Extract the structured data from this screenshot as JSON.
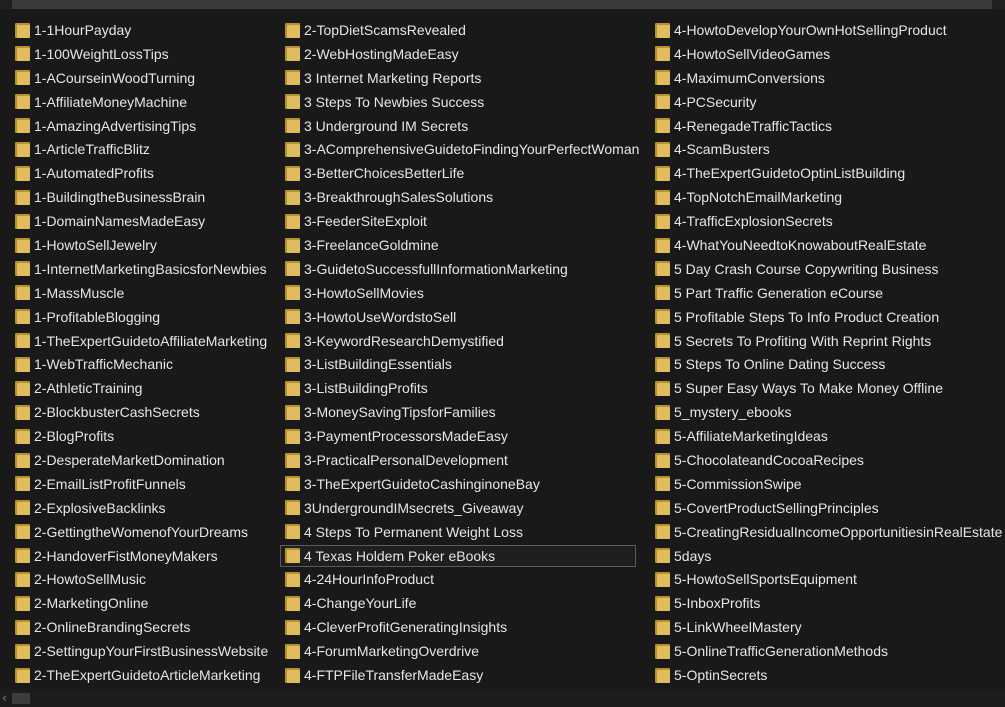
{
  "folder_icon": "folder-icon",
  "colors": {
    "background": "#191919",
    "text": "#e6e6e6",
    "folder_light": "#e1bc5e",
    "folder_dark": "#b8902e",
    "selection_border": "#5b5b5b"
  },
  "selected_item": "4 Texas Holdem Poker eBooks",
  "columns": [
    {
      "items": [
        "1-1HourPayday",
        "1-100WeightLossTips",
        "1-ACourseinWoodTurning",
        "1-AffiliateMoneyMachine",
        "1-AmazingAdvertisingTips",
        "1-ArticleTrafficBlitz",
        "1-AutomatedProfits",
        "1-BuildingtheBusinessBrain",
        "1-DomainNamesMadeEasy",
        "1-HowtoSellJewelry",
        "1-InternetMarketingBasicsforNewbies",
        "1-MassMuscle",
        "1-ProfitableBlogging",
        "1-TheExpertGuidetoAffiliateMarketing",
        "1-WebTrafficMechanic",
        "2-AthleticTraining",
        "2-BlockbusterCashSecrets",
        "2-BlogProfits",
        "2-DesperateMarketDomination",
        "2-EmailListProfitFunnels",
        "2-ExplosiveBacklinks",
        "2-GettingtheWomenofYourDreams",
        "2-HandoverFistMoneyMakers",
        "2-HowtoSellMusic",
        "2-MarketingOnline",
        "2-OnlineBrandingSecrets",
        "2-SettingupYourFirstBusinessWebsite",
        "2-TheExpertGuidetoArticleMarketing"
      ]
    },
    {
      "items": [
        "2-TopDietScamsRevealed",
        "2-WebHostingMadeEasy",
        "3 Internet Marketing Reports",
        "3 Steps To Newbies Success",
        "3 Underground IM Secrets",
        "3-AComprehensiveGuidetoFindingYourPerfectWoman",
        "3-BetterChoicesBetterLife",
        "3-BreakthroughSalesSolutions",
        "3-FeederSiteExploit",
        "3-FreelanceGoldmine",
        "3-GuidetoSuccessfullInformationMarketing",
        "3-HowtoSellMovies",
        "3-HowtoUseWordstoSell",
        "3-KeywordResearchDemystified",
        "3-ListBuildingEssentials",
        "3-ListBuildingProfits",
        "3-MoneySavingTipsforFamilies",
        "3-PaymentProcessorsMadeEasy",
        "3-PracticalPersonalDevelopment",
        "3-TheExpertGuidetoCashinginoneBay",
        "3UndergroundIMsecrets_Giveaway",
        "4 Steps To Permanent Weight Loss",
        "4 Texas Holdem Poker eBooks",
        "4-24HourInfoProduct",
        "4-ChangeYourLife",
        "4-CleverProfitGeneratingInsights",
        "4-ForumMarketingOverdrive",
        "4-FTPFileTransferMadeEasy"
      ]
    },
    {
      "items": [
        "4-HowtoDevelopYourOwnHotSellingProduct",
        "4-HowtoSellVideoGames",
        "4-MaximumConversions",
        "4-PCSecurity",
        "4-RenegadeTrafficTactics",
        "4-ScamBusters",
        "4-TheExpertGuidetoOptinListBuilding",
        "4-TopNotchEmailMarketing",
        "4-TrafficExplosionSecrets",
        "4-WhatYouNeedtoKnowaboutRealEstate",
        "5 Day Crash Course Copywriting Business",
        "5 Part Traffic Generation eCourse",
        "5 Profitable Steps To Info Product Creation",
        "5 Secrets To Profiting With Reprint Rights",
        "5 Steps To Online Dating Success",
        "5 Super Easy Ways To Make Money Offline",
        "5_mystery_ebooks",
        "5-AffiliateMarketingIdeas",
        "5-ChocolateandCocoaRecipes",
        "5-CommissionSwipe",
        "5-CovertProductSellingPrinciples",
        "5-CreatingResidualIncomeOpportunitiesinRealEstate",
        "5days",
        "5-HowtoSellSportsEquipment",
        "5-InboxProfits",
        "5-LinkWheelMastery",
        "5-OnlineTrafficGenerationMethods",
        "5-OptinSecrets"
      ]
    }
  ],
  "scrollbar": {
    "left_arrow": "‹",
    "left_arrow_icon": "chevron-left-icon"
  }
}
